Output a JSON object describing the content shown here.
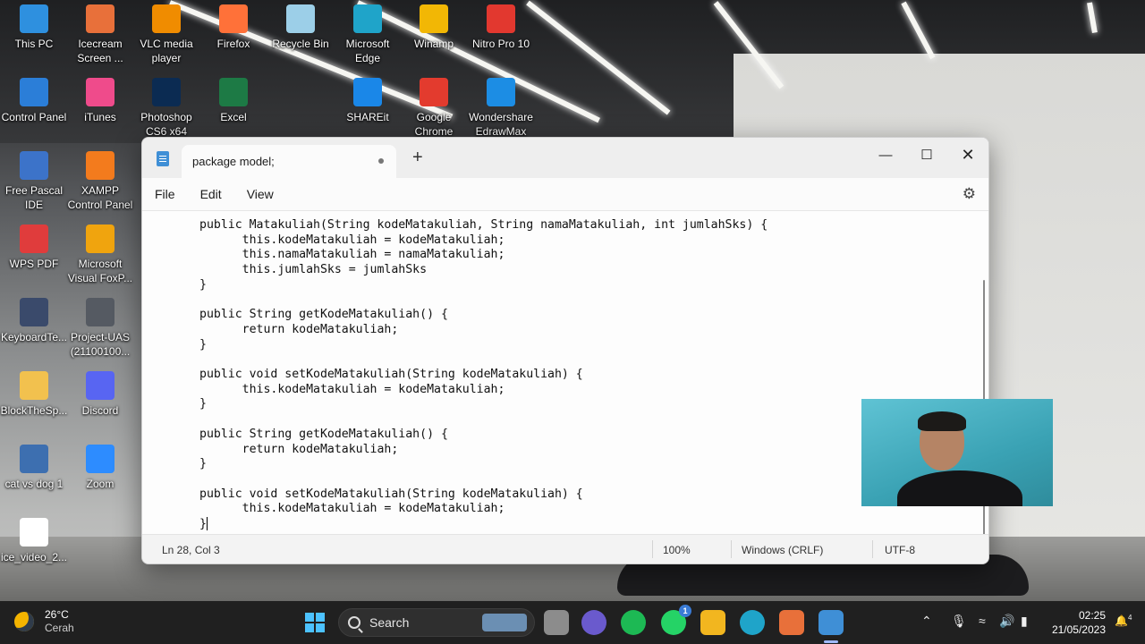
{
  "desktop": {
    "icons": [
      {
        "label": "This PC",
        "icon": "monitor-icon",
        "color": "#2e90df"
      },
      {
        "label": "Icecream Screen ...",
        "icon": "icecream-icon",
        "color": "#e8703a"
      },
      {
        "label": "VLC media player",
        "icon": "vlc-cone-icon",
        "color": "#f08c00"
      },
      {
        "label": "Firefox",
        "icon": "firefox-icon",
        "color": "#ff7139"
      },
      {
        "label": "Recycle Bin",
        "icon": "recycle-bin-icon",
        "color": "#9ccfe8"
      },
      {
        "label": "Microsoft Edge",
        "icon": "edge-icon",
        "color": "#1fa4c9"
      },
      {
        "label": "Winamp",
        "icon": "winamp-icon",
        "color": "#f2b705"
      },
      {
        "label": "Nitro Pro 10",
        "icon": "nitro-icon",
        "color": "#e2382f"
      },
      {
        "label": "Control Panel",
        "icon": "control-panel-icon",
        "color": "#2b7ed8"
      },
      {
        "label": "iTunes",
        "icon": "itunes-icon",
        "color": "#ef4b8b"
      },
      {
        "label": "Photoshop CS6 x64",
        "icon": "photoshop-icon",
        "color": "#0b2b52"
      },
      {
        "label": "Excel",
        "icon": "excel-icon",
        "color": "#1d7a45"
      },
      {
        "label": "SHAREit",
        "icon": "shareit-icon",
        "color": "#1a87e8"
      },
      {
        "label": "Google Chrome",
        "icon": "chrome-icon",
        "color": "#e33b2e"
      },
      {
        "label": "Wondershare EdrawMax",
        "icon": "edrawmax-icon",
        "color": "#1c8de4"
      },
      {
        "label": "Free Pascal IDE",
        "icon": "pascal-icon",
        "color": "#3c73c9"
      },
      {
        "label": "XAMPP Control Panel",
        "icon": "xampp-icon",
        "color": "#f37b1d"
      },
      {
        "label": "WPS PDF",
        "icon": "wps-pdf-icon",
        "color": "#e03c3c"
      },
      {
        "label": "Microsoft Visual FoxP...",
        "icon": "foxpro-icon",
        "color": "#f0a40e"
      },
      {
        "label": "KeyboardTe...",
        "icon": "keyboard-test-icon",
        "color": "#3a4a6b"
      },
      {
        "label": "Project-UAS (21100100...",
        "icon": "project-file-icon",
        "color": "#555a62"
      },
      {
        "label": "BlockTheSp...",
        "icon": "folder-icon",
        "color": "#f2c14e"
      },
      {
        "label": "Discord",
        "icon": "discord-icon",
        "color": "#5865f2"
      },
      {
        "label": "cat vs dog 1",
        "icon": "flash-icon",
        "color": "#3d6fb0"
      },
      {
        "label": "Zoom",
        "icon": "zoom-icon",
        "color": "#2d8cff"
      },
      {
        "label": "ice_video_2...",
        "icon": "video-file-icon",
        "color": "#ffffff"
      }
    ]
  },
  "notepad": {
    "tab_title": "package model;",
    "menu": {
      "file": "File",
      "edit": "Edit",
      "view": "View"
    },
    "code_lines": [
      "public Matakuliah(String kodeMatakuliah, String namaMatakuliah, int jumlahSks) {",
      "      this.kodeMatakuliah = kodeMatakuliah;",
      "      this.namaMatakuliah = namaMatakuliah;",
      "      this.jumlahSks = jumlahSks",
      "}",
      "",
      "public String getKodeMatakuliah() {",
      "      return kodeMatakuliah;",
      "}",
      "",
      "public void setKodeMatakuliah(String kodeMatakuliah) {",
      "      this.kodeMatakuliah = kodeMatakuliah;",
      "}",
      "",
      "public String getKodeMatakuliah() {",
      "      return kodeMatakuliah;",
      "}",
      "",
      "public void setKodeMatakuliah(String kodeMatakuliah) {",
      "      this.kodeMatakuliah = kodeMatakuliah;",
      "}"
    ],
    "status": {
      "position": "Ln 28, Col 3",
      "zoom": "100%",
      "line_ending": "Windows (CRLF)",
      "encoding": "UTF-8"
    }
  },
  "taskbar": {
    "weather_temp": "26°C",
    "weather_desc": "Cerah",
    "search_label": "Search",
    "whatsapp_badge": "1",
    "time": "02:25",
    "date": "21/05/2023",
    "notification_count": "4"
  }
}
